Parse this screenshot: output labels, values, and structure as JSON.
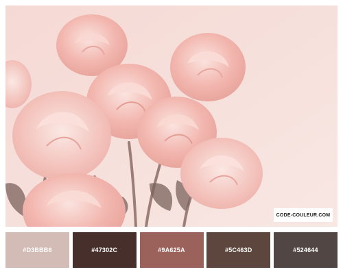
{
  "photo": {
    "subject": "pale pink roses",
    "brand_label": "CODE-COULEUR.COM"
  },
  "palette": {
    "swatches": [
      {
        "hex": "#D3BBB6",
        "label": "#D3BBB6"
      },
      {
        "hex": "#47302C",
        "label": "#47302C"
      },
      {
        "hex": "#9A625A",
        "label": "#9A625A"
      },
      {
        "hex": "#5C463D",
        "label": "#5C463D"
      },
      {
        "hex": "#524644",
        "label": "#524644"
      }
    ]
  }
}
